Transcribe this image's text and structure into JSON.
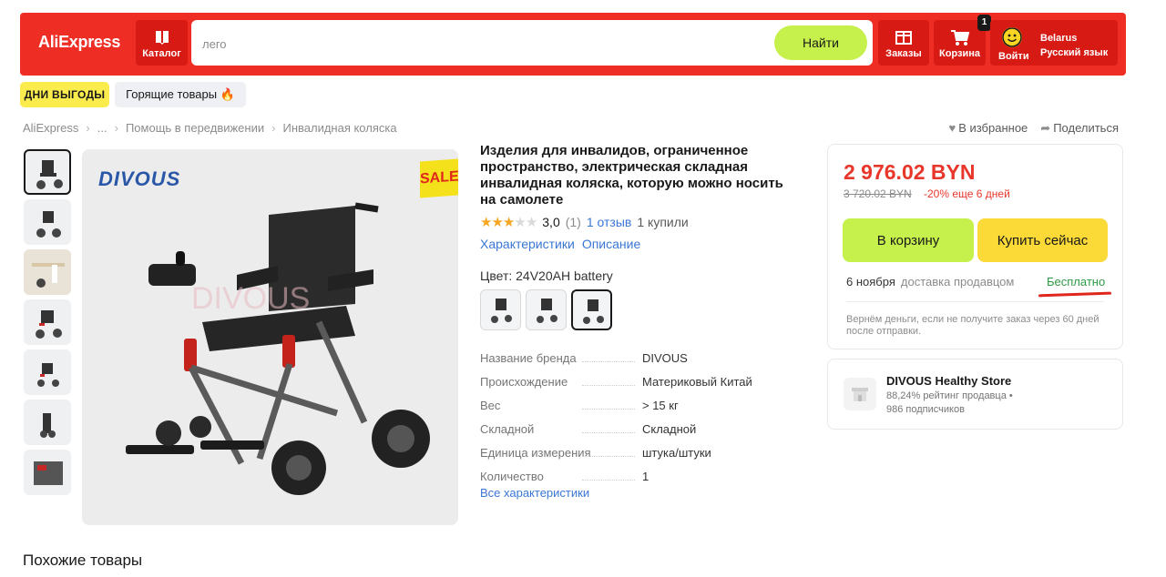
{
  "header": {
    "logo": "AliExpress",
    "catalog_label": "Каталог",
    "search_value": "лего",
    "search_button": "Найти",
    "orders_label": "Заказы",
    "cart_label": "Корзина",
    "cart_count": "1",
    "login_label": "Войти",
    "region": "Belarus",
    "language": "Русский язык"
  },
  "promo": {
    "deals_label": "ДНИ ВЫГОДЫ",
    "hot_label": "Горящие товары 🔥"
  },
  "breadcrumb": {
    "items": [
      "AliExpress",
      "...",
      "Помощь в передвижении",
      "Инвалидная коляска"
    ]
  },
  "page_actions": {
    "favorite": "В избранное",
    "share": "Поделиться"
  },
  "gallery": {
    "brand_logo": "DIVOUS",
    "sale_badge": "SALE",
    "watermark": "DIVOUS"
  },
  "product": {
    "title": "Изделия для инвалидов, ограниченное пространство, электрическая складная инвалидная коляска, которую можно носить на самолете",
    "rating_value": "3,0",
    "rating_count": "(1)",
    "reviews_link": "1 отзыв",
    "sold": "1 купили",
    "stars": 3,
    "tab_specs": "Характеристики",
    "tab_description": "Описание",
    "color_label": "Цвет: 24V20AH battery",
    "specs": [
      {
        "key": "Название бренда",
        "value": "DIVOUS"
      },
      {
        "key": "Происхождение",
        "value": "Материковый Китай"
      },
      {
        "key": "Вес",
        "value": "> 15 кг"
      },
      {
        "key": "Складной",
        "value": "Складной"
      },
      {
        "key": "Единица измерения",
        "value": "штука/штуки"
      },
      {
        "key": "Количество",
        "value": "1"
      }
    ],
    "all_specs_link": "Все характеристики"
  },
  "price_card": {
    "price": "2 976.02 BYN",
    "old_price": "3 720.02 BYN",
    "discount": "-20% еще 6 дней",
    "add_to_cart": "В корзину",
    "buy_now": "Купить сейчас",
    "delivery_date": "6 ноября",
    "delivery_by": "доставка продавцом",
    "delivery_price": "Бесплатно",
    "refund_note": "Вернём деньги, если не получите заказ через 60 дней после отправки.",
    "accent_color": "#e8362a",
    "cart_button_color": "#c6f04c",
    "buy_button_color": "#fbd936"
  },
  "store": {
    "name": "DIVOUS Healthy Store",
    "rating": "88,24% рейтинг продавца  •",
    "subscribers": "986 подписчиков"
  },
  "similar_title": "Похожие товары"
}
